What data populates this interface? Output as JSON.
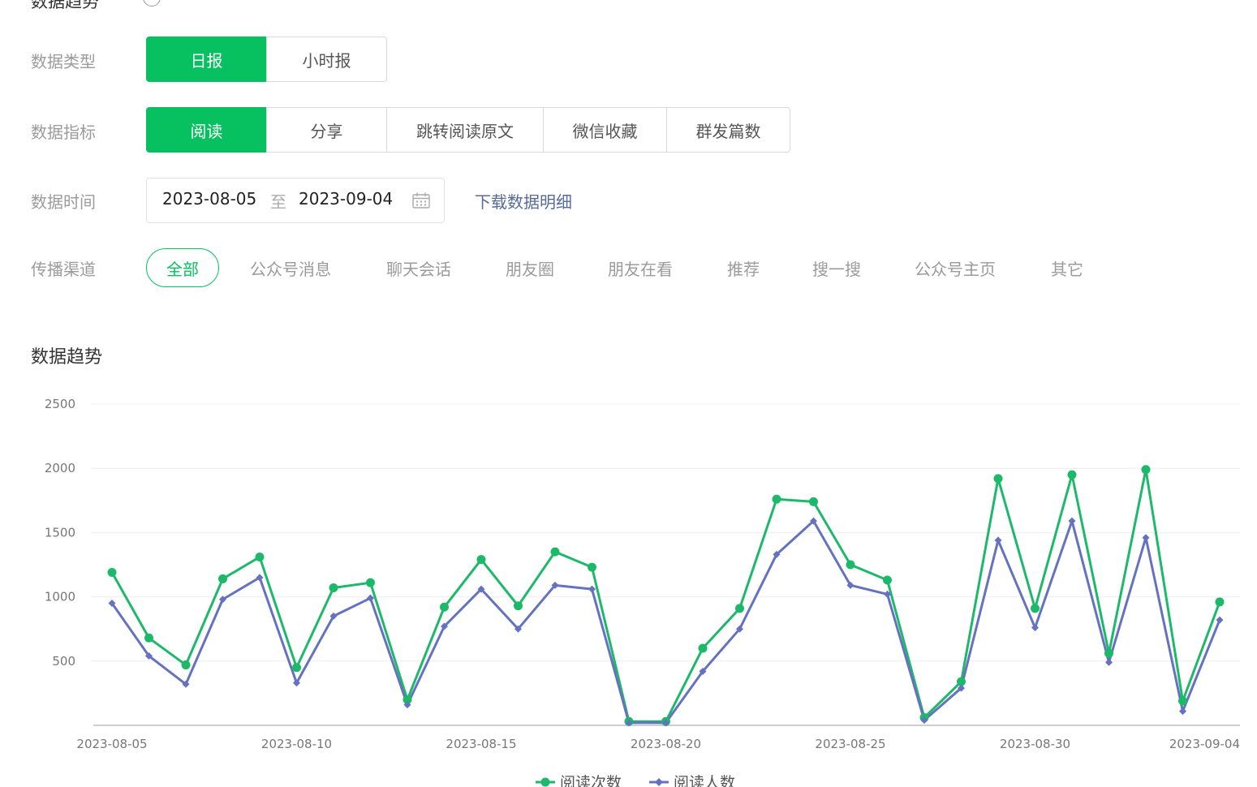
{
  "header": {
    "title": "数据趋势"
  },
  "filters": {
    "data_type": {
      "label": "数据类型",
      "options": [
        "日报",
        "小时报"
      ],
      "selected": "日报"
    },
    "metric": {
      "label": "数据指标",
      "options": [
        "阅读",
        "分享",
        "跳转阅读原文",
        "微信收藏",
        "群发篇数"
      ],
      "selected": "阅读"
    },
    "time": {
      "label": "数据时间",
      "start": "2023-08-05",
      "separator": "至",
      "end": "2023-09-04"
    },
    "download": "下载数据明细",
    "channel": {
      "label": "传播渠道",
      "selected": "全部",
      "options": [
        "全部",
        "公众号消息",
        "聊天会话",
        "朋友圈",
        "朋友在看",
        "推荐",
        "搜一搜",
        "公众号主页",
        "其它"
      ]
    }
  },
  "section_title": "数据趋势",
  "icons": {
    "help": "help-icon",
    "calendar": "calendar-icon"
  },
  "colors": {
    "accent": "#07c160",
    "link": "#576b95",
    "series_reads": "#1db96a",
    "series_users": "#6472c0"
  },
  "chart_data": {
    "type": "line",
    "x": [
      "2023-08-05",
      "2023-08-06",
      "2023-08-07",
      "2023-08-08",
      "2023-08-09",
      "2023-08-10",
      "2023-08-11",
      "2023-08-12",
      "2023-08-13",
      "2023-08-14",
      "2023-08-15",
      "2023-08-16",
      "2023-08-17",
      "2023-08-18",
      "2023-08-19",
      "2023-08-20",
      "2023-08-21",
      "2023-08-22",
      "2023-08-23",
      "2023-08-24",
      "2023-08-25",
      "2023-08-26",
      "2023-08-27",
      "2023-08-28",
      "2023-08-29",
      "2023-08-30",
      "2023-08-31",
      "2023-09-01",
      "2023-09-02",
      "2023-09-03",
      "2023-09-04"
    ],
    "x_ticks": [
      "2023-08-05",
      "2023-08-10",
      "2023-08-15",
      "2023-08-20",
      "2023-08-25",
      "2023-08-30",
      "2023-09-04"
    ],
    "ylim": [
      0,
      2500
    ],
    "y_ticks": [
      500,
      1000,
      1500,
      2000,
      2500
    ],
    "grid": true,
    "legend": "bottom-center",
    "series": [
      {
        "name": "阅读次数",
        "marker": "circle",
        "values": [
          1190,
          680,
          470,
          1140,
          1310,
          450,
          1070,
          1110,
          200,
          920,
          1290,
          930,
          1350,
          1230,
          30,
          30,
          600,
          910,
          1760,
          1740,
          1250,
          1130,
          60,
          340,
          1920,
          910,
          1950,
          560,
          1990,
          190,
          960
        ]
      },
      {
        "name": "阅读人数",
        "marker": "diamond",
        "values": [
          950,
          540,
          320,
          980,
          1150,
          330,
          850,
          990,
          160,
          770,
          1060,
          750,
          1090,
          1060,
          20,
          20,
          420,
          750,
          1330,
          1590,
          1090,
          1020,
          40,
          290,
          1440,
          760,
          1590,
          490,
          1460,
          110,
          820
        ]
      }
    ]
  }
}
